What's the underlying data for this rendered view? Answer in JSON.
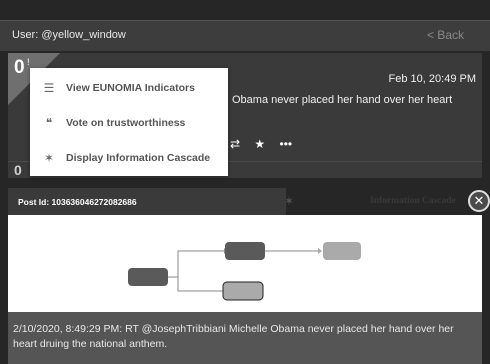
{
  "header": {
    "user_label": "User: @yellow_window",
    "back_label": "< Back"
  },
  "feed": {
    "score": "0",
    "score_sup": "!",
    "date": "Feb 10, 20:49 PM",
    "text_fragment": "Obama never placed her hand over her heart",
    "actions": [
      "⇄",
      "★",
      "•••"
    ],
    "score_next": "0"
  },
  "menu": {
    "items": [
      {
        "icon": "list-icon",
        "glyph": "☰",
        "label": "View EUNOMIA Indicators"
      },
      {
        "icon": "thumbs-icon",
        "glyph": "❝",
        "label": "Vote on trustworthiness"
      },
      {
        "icon": "cascade-icon",
        "glyph": "✶",
        "label": "Display Information Cascade"
      }
    ]
  },
  "panel": {
    "post_id": "Post Id: 1036360462720826​86",
    "cascade_title": "Information Cascade",
    "footer_text": "2/10/2020, 8:49:29 PM: RT @JosephTribbiani Michelle Obama never  placed her hand over her heart druing the national anthem.",
    "close_glyph": "✕"
  },
  "colors": {
    "node_dark": "#5a5a5a",
    "node_light": "#aaaaaa",
    "edge": "#8a8a8a"
  }
}
